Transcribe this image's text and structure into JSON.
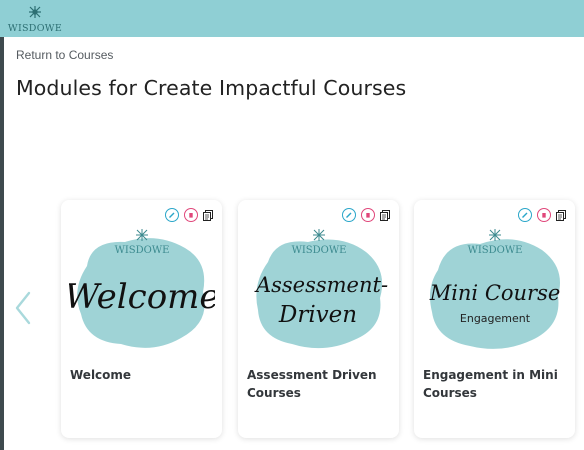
{
  "header": {
    "logo_text": "WISDOWE",
    "brand_color": "#8fcfd4"
  },
  "nav": {
    "return_link": "Return to Courses"
  },
  "page": {
    "title": "Modules for Create Impactful Courses"
  },
  "carousel": {
    "prev_icon": "chevron-left-icon",
    "accent_color": "#9fd3d6",
    "modules": [
      {
        "title": "Welcome",
        "art_logo": "WISDOWE",
        "art_script": "Welcome",
        "art_subtitle": "",
        "actions": [
          "edit-icon",
          "delete-icon",
          "copy-icon"
        ]
      },
      {
        "title": "Assessment Driven Courses",
        "art_logo": "WISDOWE",
        "art_script_line1": "Assessment-",
        "art_script_line2": "Driven",
        "art_subtitle": "",
        "actions": [
          "edit-icon",
          "delete-icon",
          "copy-icon"
        ]
      },
      {
        "title": "Engagement in Mini Courses",
        "art_logo": "WISDOWE",
        "art_script": "Mini Course",
        "art_subtitle": "Engagement",
        "actions": [
          "edit-icon",
          "delete-icon",
          "copy-icon"
        ]
      }
    ]
  }
}
